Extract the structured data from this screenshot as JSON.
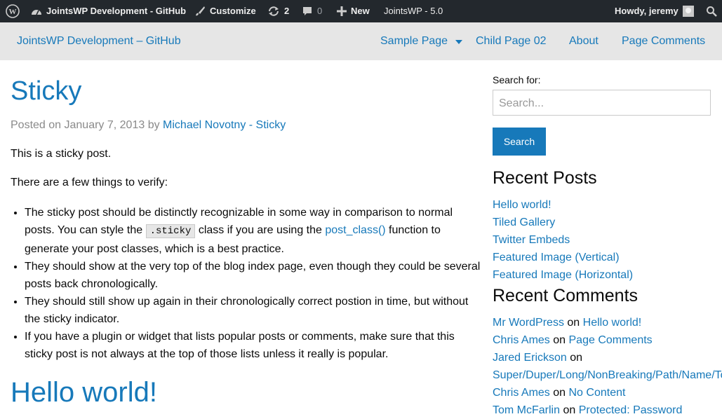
{
  "admin_bar": {
    "site_name": "JointsWP Development - GitHub",
    "customize": "Customize",
    "updates_count": "2",
    "comments_count": "0",
    "new_label": "New",
    "version": "JointsWP - 5.0",
    "howdy": "Howdy, jeremy"
  },
  "header": {
    "site_title": "JointsWP Development – GitHub",
    "nav": [
      "Sample Page",
      "Child Page 02",
      "About",
      "Page Comments"
    ]
  },
  "post": {
    "title": "Sticky",
    "byline_prefix": "Posted on January 7, 2013 by ",
    "author": "Michael Novotny - Sticky",
    "para1": "This is a sticky post.",
    "para2": "There are a few things to verify:",
    "b1_a": "The sticky post should be distinctly recognizable in some way in comparison to normal posts. You can style the ",
    "b1_code": ".sticky",
    "b1_b": " class if you are using the ",
    "b1_link": "post_class()",
    "b1_c": " function to generate your post classes, which is a best practice.",
    "b2": "They should show at the very top of the blog index page, even though they could be several posts back chronologically.",
    "b3": "They should still show up again in their chronologically correct postion in time, but without the sticky indicator.",
    "b4": "If you have a plugin or widget that lists popular posts or comments, make sure that this sticky post is not always at the top of those lists unless it really is popular."
  },
  "post2": {
    "title": "Hello world!"
  },
  "sidebar": {
    "search_label": "Search for:",
    "search_placeholder": "Search...",
    "search_button": "Search",
    "recent_posts_title": "Recent Posts",
    "recent_posts": [
      "Hello world!",
      "Tiled Gallery",
      "Twitter Embeds",
      "Featured Image (Vertical)",
      "Featured Image (Horizontal)"
    ],
    "recent_comments_title": "Recent Comments",
    "on_word": "on",
    "recent_comments": [
      {
        "author": "Mr WordPress",
        "post": "Hello world!"
      },
      {
        "author": "Chris Ames",
        "post": "Page Comments"
      },
      {
        "author": "Jared Erickson",
        "post": "Super/Duper/Long/NonBreaking/Path/Name/To"
      },
      {
        "author": "Chris Ames",
        "post": "No Content"
      },
      {
        "author": "Tom McFarlin",
        "post": "Protected: Password"
      }
    ]
  },
  "colors": {
    "link": "#1779ba",
    "admin_bar": "#23282d",
    "nav_bg": "#e6e6e6"
  }
}
